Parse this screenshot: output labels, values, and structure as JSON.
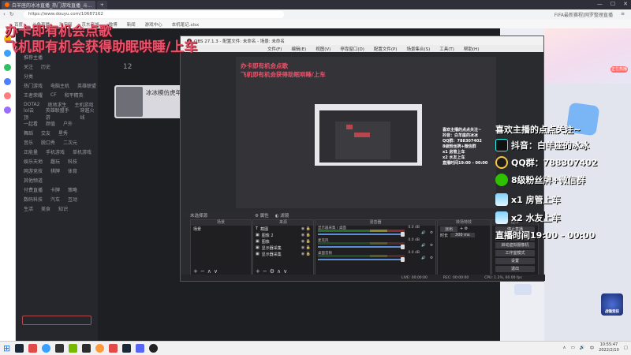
{
  "browser": {
    "tabs": [
      {
        "label": "白羊座的冰冰直播_热门游戏直播_斗..."
      },
      {
        "label": "+"
      }
    ],
    "url": "https://www.douyu.com/10687162",
    "right_extra": "FIFA最新赛程|网罗整理直播",
    "bookmarks": [
      "百度",
      "斗鱼直播",
      "淘宝网",
      "京东商城",
      "微博",
      "新闻",
      "游戏中心",
      "本机笔记.xlsx"
    ]
  },
  "overlay": {
    "line1": "办卡即有机会点歌",
    "line2": "飞机即有机会获得助眠哄睡/上车"
  },
  "info_panel": {
    "title": "喜欢主播的点点关注~",
    "rows": [
      {
        "icon": "tiktok-icon",
        "text": "抖音：白羊座的冰冰"
      },
      {
        "icon": "qq-icon",
        "text": "QQ群：788307402"
      },
      {
        "icon": "wechat-icon",
        "text": "8级粉丝牌+微信群"
      },
      {
        "icon": "plane-icon",
        "text": "x1 房管上车"
      },
      {
        "icon": "plane-icon",
        "text": "x2 水友上车"
      }
    ],
    "schedule": "直播时间19:00 - 00:00"
  },
  "douyu": {
    "follow_count": "12",
    "room_title": "冰冰模仿虎年平...",
    "right_fire": "正在热播",
    "sidebar_rows": [
      [
        "推荐主播"
      ],
      [
        "关注",
        "历史"
      ],
      [
        "分类"
      ],
      [
        "热门游戏",
        "电脑主机",
        "英雄联盟"
      ],
      [
        "王者荣耀",
        "CF",
        "和平精英"
      ],
      [
        "DOTA2",
        "绝地求生",
        "主机游戏"
      ],
      [
        "lol云顶",
        "英雄联盟手游",
        "穿越火线"
      ],
      [
        "一起看",
        "颜值",
        "户外"
      ],
      [
        "舞蹈",
        "交友",
        "星秀"
      ],
      [
        "音乐",
        "脱口秀",
        "二次元"
      ],
      [
        "正能量",
        "手机游戏",
        "单机游戏"
      ],
      [
        "娱乐天地",
        "趣玩",
        "科技"
      ],
      [
        "网游竞技",
        "棋牌",
        "体育"
      ],
      [
        "其他频道"
      ],
      [
        "付费直播",
        "卡牌",
        "策略"
      ],
      [
        "数码科技",
        "汽车",
        "互动"
      ],
      [
        "生活",
        "美食",
        "知识"
      ]
    ]
  },
  "obs": {
    "title": "OBS 27.1.3 - 配置文件: 未命名 - 场景: 未命名",
    "menu": [
      "文件(F)",
      "编辑(E)",
      "视图(V)",
      "停靠窗口(D)",
      "配置文件(P)",
      "场景集合(S)",
      "工具(T)",
      "帮助(H)"
    ],
    "no_source": "未选择源",
    "btn_props": "属性",
    "btn_filters": "滤镜",
    "scenes_header": "场景",
    "scenes": [
      "场景"
    ],
    "sources_header": "来源",
    "sources": [
      {
        "icon": "text-icon",
        "label": "截图"
      },
      {
        "icon": "capture-icon",
        "label": "图像 2"
      },
      {
        "icon": "capture-icon",
        "label": "图像"
      },
      {
        "icon": "capture-icon",
        "label": "显示器采集"
      },
      {
        "icon": "capture-icon",
        "label": "显示器采集"
      }
    ],
    "mixer_header": "混音器",
    "mixer": [
      {
        "label": "显示器采集 / 桌面",
        "db": "0.0 dB"
      },
      {
        "label": "麦克风",
        "db": "0.0 dB"
      },
      {
        "label": "桌面音频",
        "db": "0.0 dB"
      }
    ],
    "transition_header": "转场特效",
    "transition_type": "淡出",
    "duration_label": "时长",
    "duration_value": "300 ms",
    "controls": [
      "停止直播",
      "开始录制",
      "启动虚拟摄像机",
      "工作室模式",
      "设置",
      "退出"
    ],
    "status": [
      "LIVE: 00:00:00",
      "REC: 00:00:00",
      "CPU: 1.2%, 60.00 fps"
    ],
    "preview": {
      "red1": "办卡即有机会点歌",
      "red2": "飞机即有机会获得助眠哄睡/上车",
      "info_title": "喜欢主播的点点关注~",
      "info_rows": [
        "抖音：白羊座的冰冰",
        "QQ群：788307402",
        "8级粉丝牌+微信群",
        "x1 房管上车",
        "x2 水友上车",
        "直播时间19:00 - 00:00"
      ]
    }
  },
  "badge": {
    "text": "战锤竞技"
  },
  "taskbar": {
    "tray_lang": "中",
    "time": "10:55:47",
    "date": "2022/2/10"
  },
  "colors": {
    "accent_red": "#e9536b",
    "obs_bg": "#2a2b2f",
    "sidebar_bg": "#26272c"
  }
}
